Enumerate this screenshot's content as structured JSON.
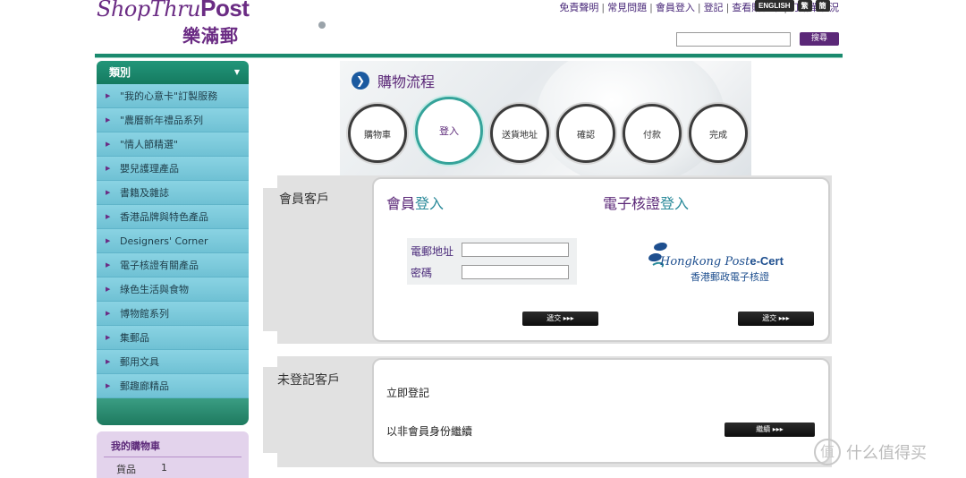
{
  "header": {
    "logo_en_1": "ShopThru",
    "logo_en_2": "Post",
    "logo_zh": "樂滿郵",
    "topnav": [
      "免責聲明",
      "常見問題",
      "會員登入",
      "登記",
      "查看購物車",
      "訂購單狀況"
    ],
    "lang": [
      "ENGLISH",
      "繁",
      "簡"
    ],
    "search_placeholder": "",
    "search_button": "搜尋"
  },
  "sidebar": {
    "title": "類別",
    "items": [
      "\"我的心意卡\"訂製服務",
      "\"農曆新年禮品系列",
      "\"情人節精選\"",
      "嬰兒護理產品",
      "書籍及雜誌",
      "香港品牌與特色產品",
      "Designers' Corner",
      "電子核證有關產品",
      "綠色生活與食物",
      "博物館系列",
      "集郵品",
      "郵用文具",
      "郵趣廊精品"
    ],
    "cart": {
      "title": "我的購物車",
      "item_label": "貨品",
      "item_count": "1"
    }
  },
  "process": {
    "title": "購物流程",
    "steps": [
      "購物車",
      "登入",
      "送貨地址",
      "確認",
      "付款",
      "完成"
    ],
    "active_step": "登入"
  },
  "member": {
    "section_label": "會員客戶",
    "title_part1": "會員",
    "title_part2": "登入",
    "email_label": "電郵地址",
    "password_label": "密碼",
    "submit": "遞交  ▸▸▸"
  },
  "ecert": {
    "title_part1": "電子核證",
    "title_part2": "登入",
    "logo_en": "Hongkong Post",
    "logo_en_bold": "e-Cert",
    "logo_zh": "香港郵政電子核證",
    "submit": "遞交  ▸▸▸"
  },
  "guest": {
    "section_label": "未登記客戶",
    "register": "立即登記",
    "continue_text": "以非會員身份繼續",
    "continue_button": "繼續  ▸▸▸"
  },
  "watermark": {
    "text": "什么值得买",
    "icon": "值"
  },
  "colors": {
    "brand_purple": "#5b2878",
    "green": "#1a8a6e",
    "sidebar_blue": "#77c9dc",
    "teal_active": "#35a39a"
  }
}
